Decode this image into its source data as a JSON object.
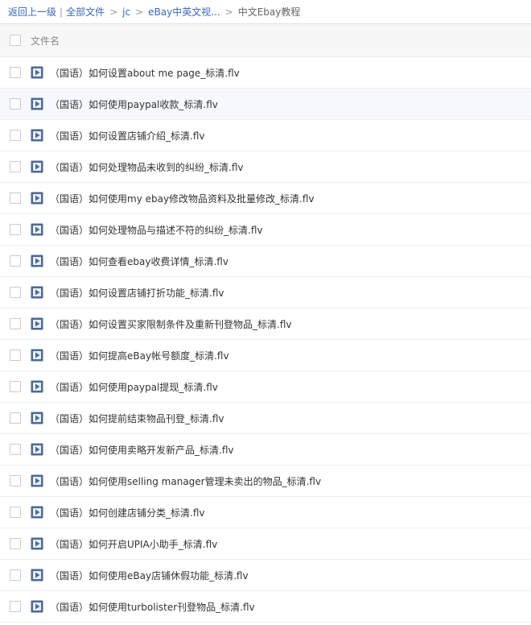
{
  "breadcrumb": {
    "back_label": "返回上一级",
    "separator": "|",
    "all_files_label": "全部文件",
    "arrow": ">",
    "items": [
      "jc",
      "eBay中英文视..."
    ],
    "current": "中文Ebay教程"
  },
  "list": {
    "header_label": "文件名",
    "files": [
      "（国语）如何设置about me page_标清.flv",
      "（国语）如何使用paypal收款_标清.flv",
      "（国语）如何设置店铺介绍_标清.flv",
      "（国语）如何处理物品未收到的纠纷_标清.flv",
      "（国语）如何使用my ebay修改物品资料及批量修改_标清.flv",
      "（国语）如何处理物品与描述不符的纠纷_标清.flv",
      "（国语）如何查看ebay收费详情_标清.flv",
      "（国语）如何设置店铺打折功能_标清.flv",
      "（国语）如何设置买家限制条件及重新刊登物品_标清.flv",
      "（国语）如何提高eBay帐号额度_标清.flv",
      "（国语）如何使用paypal提现_标清.flv",
      "（国语）如何提前结束物品刊登_标清.flv",
      "（国语）如何使用卖略开发新产品_标清.flv",
      "（国语）如何使用selling manager管理未卖出的物品_标清.flv",
      "（国语）如何创建店铺分类_标清.flv",
      "（国语）如何开启UPIA小助手_标清.flv",
      "（国语）如何使用eBay店铺休假功能_标清.flv",
      "（国语）如何使用turbolister刊登物品_标清.flv"
    ]
  },
  "icons": {
    "file_icon": "video-file-icon",
    "checkbox": "checkbox"
  },
  "colors": {
    "link": "#3b67b2",
    "icon": "#4c6a92",
    "header_bg": "#f7f7f7",
    "selected_row_bg": "#f5f9fe"
  }
}
